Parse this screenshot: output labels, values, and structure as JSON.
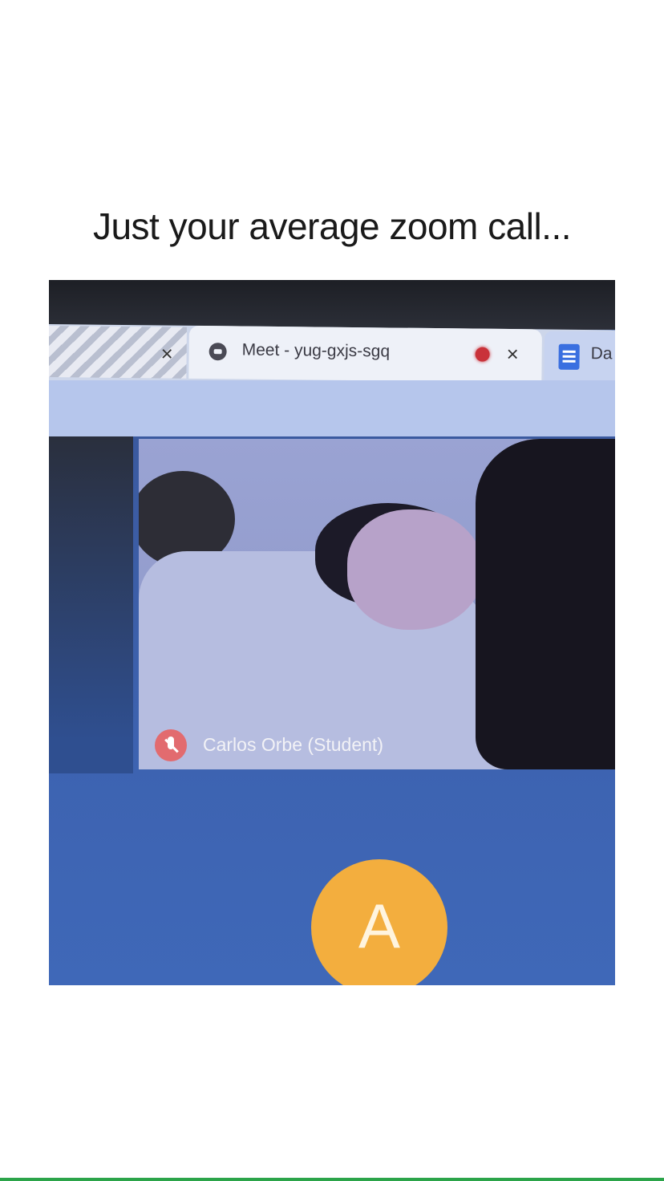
{
  "caption": "Just your average zoom call...",
  "browser": {
    "tabs": [
      {
        "label": "",
        "close": "×"
      },
      {
        "label": "Meet - yug-gxjs-sgq",
        "icon": "meet-icon",
        "recording": true,
        "close": "×"
      },
      {
        "label": "Da",
        "icon": "docs-icon"
      }
    ]
  },
  "meeting": {
    "participant_name": "Carlos Orbe (Student)",
    "participant_muted": true,
    "self_avatar_letter": "A",
    "avatar_color": "#f3ae3e",
    "background_color": "#3f68b8",
    "recording_color": "#c9323a"
  }
}
